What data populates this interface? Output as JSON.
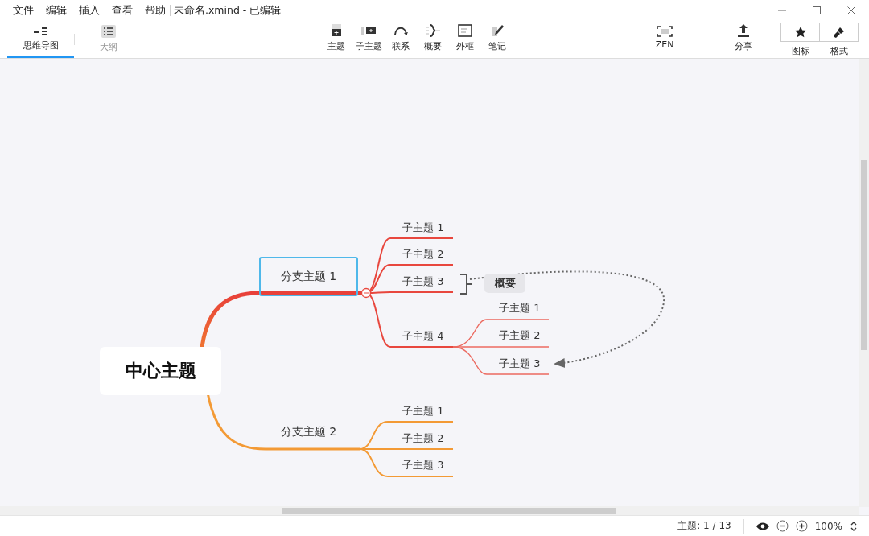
{
  "menu": [
    "文件",
    "编辑",
    "插入",
    "查看",
    "帮助"
  ],
  "title": "未命名.xmind - 已编辑",
  "view_tabs": [
    {
      "label": "思维导图",
      "kind": "mindmap",
      "selected": true
    },
    {
      "label": "大纲",
      "kind": "outline",
      "selected": false
    }
  ],
  "tools": [
    {
      "label": "主题",
      "kind": "topic"
    },
    {
      "label": "子主题",
      "kind": "subtopic"
    },
    {
      "label": "联系",
      "kind": "relationship"
    },
    {
      "label": "概要",
      "kind": "summary"
    },
    {
      "label": "外框",
      "kind": "boundary"
    },
    {
      "label": "笔记",
      "kind": "note"
    }
  ],
  "zen": "ZEN",
  "share": "分享",
  "panel_tabs": [
    {
      "label": "图标",
      "kind": "icon"
    },
    {
      "label": "格式",
      "kind": "format"
    }
  ],
  "map": {
    "central": "中心主题",
    "branches": [
      {
        "label": "分支主题 1",
        "selected": true,
        "children": [
          {
            "label": "子主题 1"
          },
          {
            "label": "子主题 2"
          },
          {
            "label": "子主题 3"
          },
          {
            "label": "子主题 4",
            "children": [
              {
                "label": "子主题 1"
              },
              {
                "label": "子主题 2"
              },
              {
                "label": "子主题 3"
              }
            ]
          }
        ],
        "summary": "概要"
      },
      {
        "label": "分支主题 2",
        "selected": false,
        "children": [
          {
            "label": "子主题 1"
          },
          {
            "label": "子主题 2"
          },
          {
            "label": "子主题 3"
          }
        ]
      }
    ]
  },
  "status": {
    "topics": "主题: 1 / 13",
    "zoom": "100%"
  }
}
